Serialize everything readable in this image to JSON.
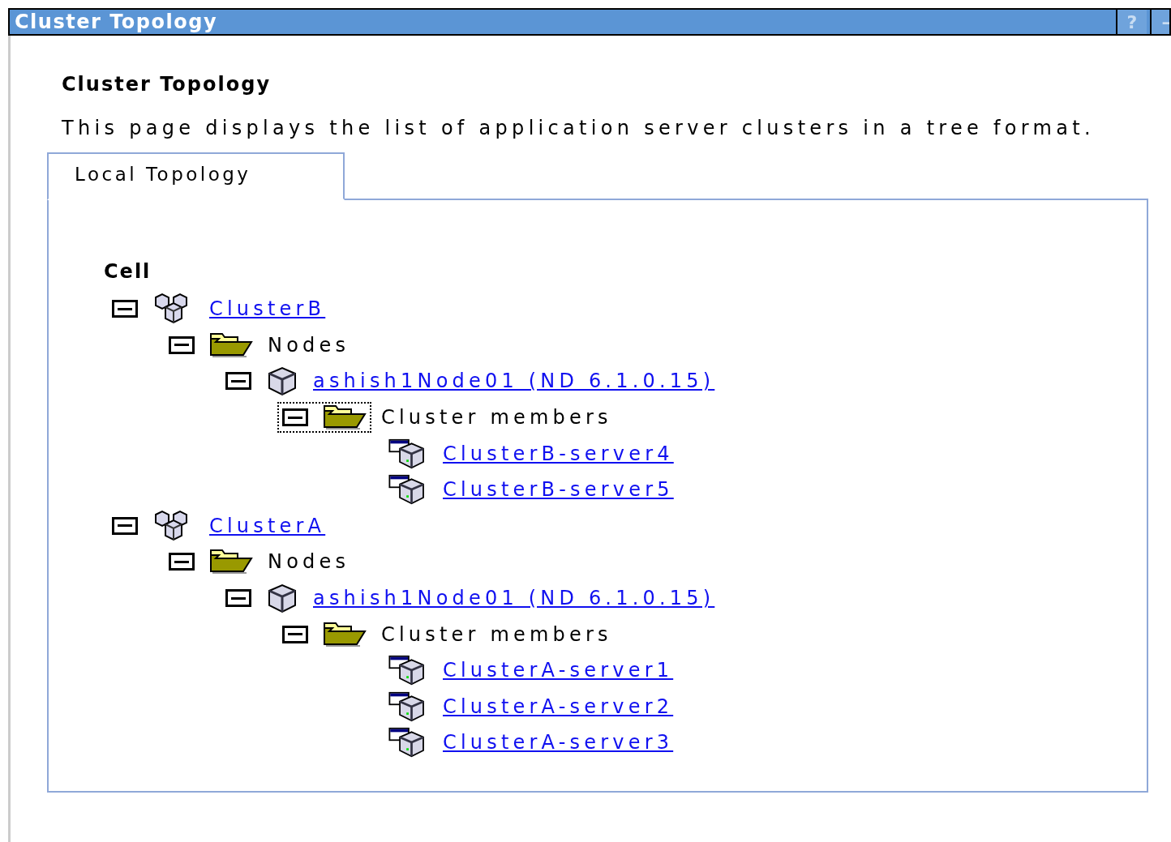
{
  "window": {
    "title": "Cluster Topology",
    "buttons": [
      "?",
      "–"
    ]
  },
  "heading": "Cluster Topology",
  "description": "This page displays the list of application server clusters in a tree format.",
  "tabs": [
    {
      "label": "Local Topology",
      "selected": true
    }
  ],
  "tree": {
    "root": "Cell",
    "items": [
      {
        "kind": "cluster",
        "label": "ClusterB",
        "link": true,
        "expanded": true,
        "focused": false,
        "children": [
          {
            "kind": "folder",
            "label": "Nodes",
            "link": false,
            "expanded": true,
            "focused": false,
            "children": [
              {
                "kind": "node",
                "label": "ashish1Node01 (ND 6.1.0.15)",
                "link": true,
                "expanded": true,
                "focused": false,
                "children": [
                  {
                    "kind": "folder",
                    "label": "Cluster members",
                    "link": false,
                    "expanded": true,
                    "focused": true,
                    "children": [
                      {
                        "kind": "server",
                        "label": "ClusterB-server4",
                        "link": true,
                        "focused": false
                      },
                      {
                        "kind": "server",
                        "label": "ClusterB-server5",
                        "link": true,
                        "focused": false
                      }
                    ]
                  }
                ]
              }
            ]
          }
        ]
      },
      {
        "kind": "cluster",
        "label": "ClusterA",
        "link": true,
        "expanded": true,
        "focused": false,
        "children": [
          {
            "kind": "folder",
            "label": "Nodes",
            "link": false,
            "expanded": true,
            "focused": false,
            "children": [
              {
                "kind": "node",
                "label": "ashish1Node01 (ND 6.1.0.15)",
                "link": true,
                "expanded": true,
                "focused": false,
                "children": [
                  {
                    "kind": "folder",
                    "label": "Cluster members",
                    "link": false,
                    "expanded": true,
                    "focused": false,
                    "children": [
                      {
                        "kind": "server",
                        "label": "ClusterA-server1",
                        "link": true,
                        "focused": false
                      },
                      {
                        "kind": "server",
                        "label": "ClusterA-server2",
                        "link": true,
                        "focused": false
                      },
                      {
                        "kind": "server",
                        "label": "ClusterA-server3",
                        "link": true,
                        "focused": false
                      }
                    ]
                  }
                ]
              }
            ]
          }
        ]
      }
    ]
  }
}
